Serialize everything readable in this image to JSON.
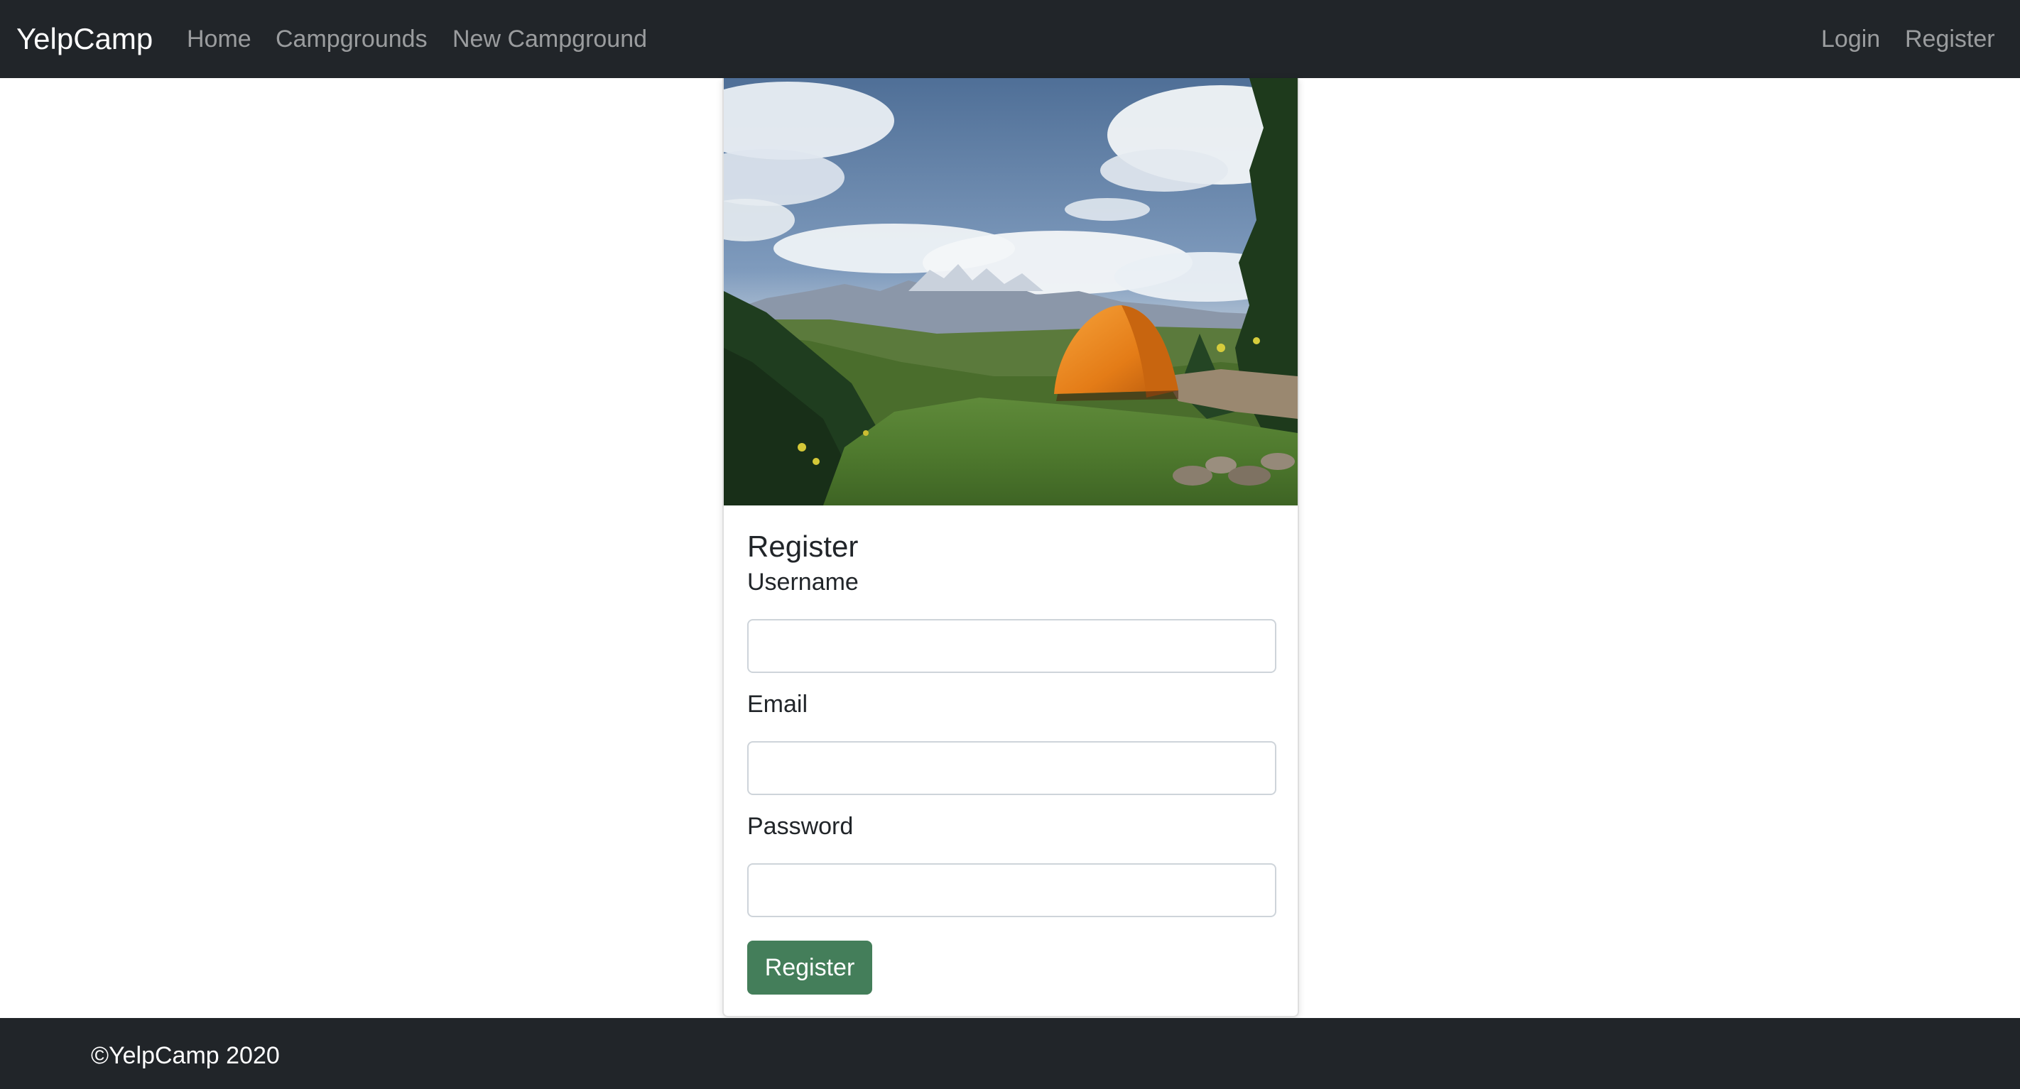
{
  "navbar": {
    "brand": "YelpCamp",
    "links": [
      {
        "label": "Home"
      },
      {
        "label": "Campgrounds"
      },
      {
        "label": "New Campground"
      }
    ],
    "right_links": [
      {
        "label": "Login"
      },
      {
        "label": "Register"
      }
    ]
  },
  "card": {
    "title": "Register",
    "fields": [
      {
        "label": "Username",
        "value": "",
        "placeholder": ""
      },
      {
        "label": "Email",
        "value": "",
        "placeholder": ""
      },
      {
        "label": "Password",
        "value": "",
        "placeholder": ""
      }
    ],
    "submit_label": "Register"
  },
  "footer": {
    "text": "©YelpCamp 2020"
  },
  "colors": {
    "navbar_bg": "#212529",
    "button_bg": "#447e5a"
  }
}
